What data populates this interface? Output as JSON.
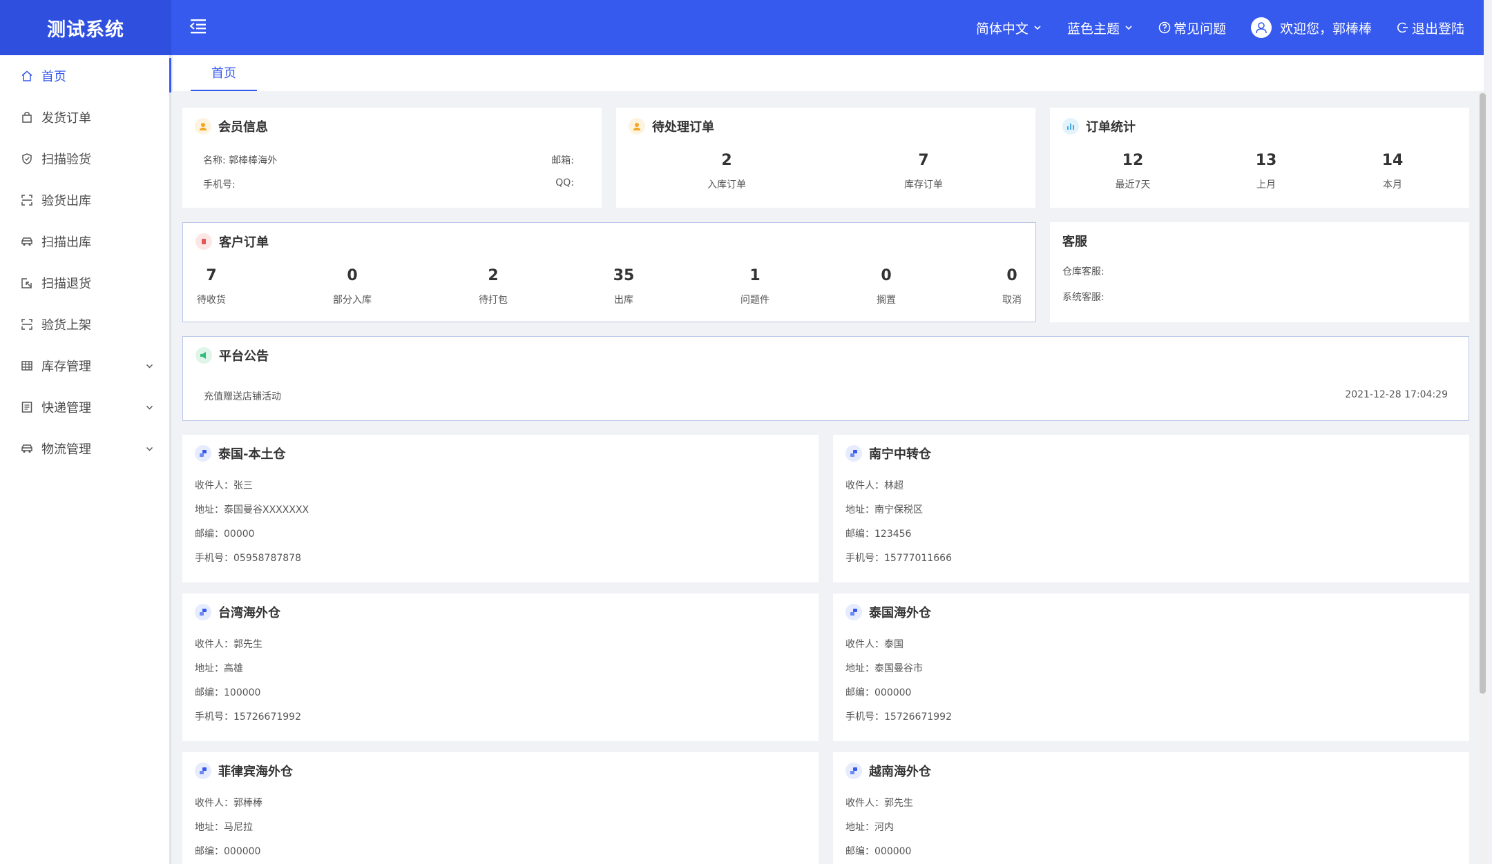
{
  "app": {
    "title": "测试系统",
    "language": "简体中文",
    "theme": "蓝色主题",
    "faq": "常见问题",
    "welcome": "欢迎您，郭棒棒",
    "logout": "退出登陆",
    "accent": "#3659ee"
  },
  "sidebar": {
    "items": [
      {
        "label": "首页",
        "icon": "home-icon"
      },
      {
        "label": "发货订单",
        "icon": "bag-icon"
      },
      {
        "label": "扫描验货",
        "icon": "shield-icon"
      },
      {
        "label": "验货出库",
        "icon": "scan-icon"
      },
      {
        "label": "扫描出库",
        "icon": "car-icon"
      },
      {
        "label": "扫描退货",
        "icon": "return-icon"
      },
      {
        "label": "验货上架",
        "icon": "scan-icon"
      },
      {
        "label": "库存管理",
        "icon": "grid-icon"
      },
      {
        "label": "快递管理",
        "icon": "list-icon"
      },
      {
        "label": "物流管理",
        "icon": "truck-icon"
      }
    ]
  },
  "tabs": [
    {
      "label": "首页"
    }
  ],
  "member": {
    "title": "会员信息",
    "name_label": "名称:",
    "name_value": "郭棒棒海外",
    "email_label": "邮箱:",
    "phone_label": "手机号:",
    "qq_label": "QQ:"
  },
  "pending": {
    "title": "待处理订单",
    "stats": [
      {
        "value": "2",
        "label": "入库订单"
      },
      {
        "value": "7",
        "label": "库存订单"
      }
    ]
  },
  "order_stats": {
    "title": "订单统计",
    "stats": [
      {
        "value": "12",
        "label": "最近7天"
      },
      {
        "value": "13",
        "label": "上月"
      },
      {
        "value": "14",
        "label": "本月"
      }
    ]
  },
  "customer_orders": {
    "title": "客户订单",
    "stats": [
      {
        "value": "7",
        "label": "待收货"
      },
      {
        "value": "0",
        "label": "部分入库"
      },
      {
        "value": "2",
        "label": "待打包"
      },
      {
        "value": "35",
        "label": "出库"
      },
      {
        "value": "1",
        "label": "问题件"
      },
      {
        "value": "0",
        "label": "搁置"
      },
      {
        "value": "0",
        "label": "取消"
      }
    ]
  },
  "service": {
    "title": "客服",
    "warehouse_label": "仓库客服:",
    "system_label": "系统客服:"
  },
  "announcement": {
    "title": "平台公告",
    "text": "充值赠送店铺活动",
    "date": "2021-12-28 17:04:29"
  },
  "warehouse_labels": {
    "receiver": "收件人",
    "address": "地址",
    "postcode": "邮编",
    "phone": "手机号"
  },
  "warehouses": [
    {
      "name": "泰国-本土仓",
      "receiver": "张三",
      "address": "泰国曼谷XXXXXXX",
      "postcode": "00000",
      "phone": "05958787878"
    },
    {
      "name": "南宁中转仓",
      "receiver": "林超",
      "address": "南宁保税区",
      "postcode": "123456",
      "phone": "15777011666"
    },
    {
      "name": "台湾海外仓",
      "receiver": "郭先生",
      "address": "高雄",
      "postcode": "100000",
      "phone": "15726671992"
    },
    {
      "name": "泰国海外仓",
      "receiver": "泰国",
      "address": "泰国曼谷市",
      "postcode": "000000",
      "phone": "15726671992"
    },
    {
      "name": "菲律宾海外仓",
      "receiver": "郭棒棒",
      "address": "马尼拉",
      "postcode": "000000"
    },
    {
      "name": "越南海外仓",
      "receiver": "郭先生",
      "address": "河内",
      "postcode": "000000"
    }
  ]
}
